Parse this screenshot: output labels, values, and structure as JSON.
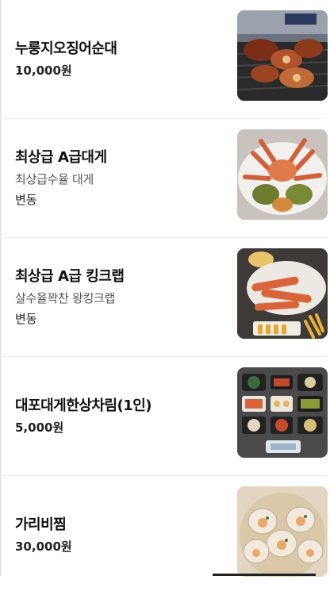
{
  "menu": [
    {
      "name": "누룽지오징어순대",
      "description": null,
      "price": "10,000원",
      "image": "grilled-squid-sundae-photo"
    },
    {
      "name": "최상급 A급대게",
      "description": "최상급수율 대게",
      "price": "변동",
      "image": "snow-crab-platter-photo"
    },
    {
      "name": "최상급 A급 킹크랩",
      "description": "살수율꽉찬 왕킹크랩",
      "price": "변동",
      "image": "king-crab-platter-photo"
    },
    {
      "name": "대포대게한상차림(1인)",
      "description": null,
      "price": "5,000원",
      "image": "set-table-sides-photo"
    },
    {
      "name": "가리비찜",
      "description": null,
      "price": "30,000원",
      "image": "steamed-scallops-photo"
    }
  ]
}
